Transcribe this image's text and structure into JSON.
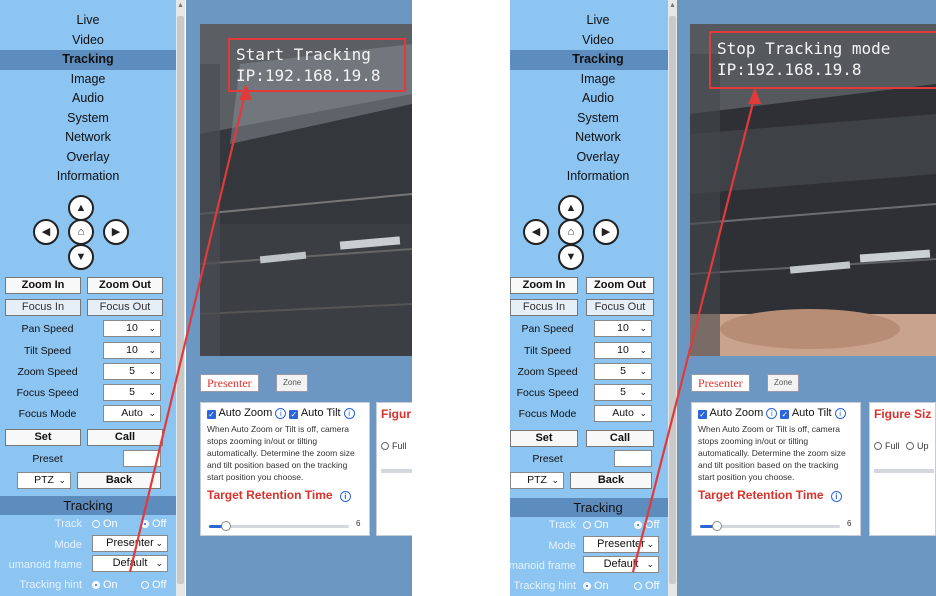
{
  "panels": [
    {
      "menu": [
        "Live",
        "Video",
        "Tracking",
        "Image",
        "Audio",
        "System",
        "Network",
        "Overlay",
        "Information"
      ],
      "active_menu": "Tracking",
      "buttons": {
        "zoom_in": "Zoom In",
        "zoom_out": "Zoom Out",
        "focus_in": "Focus In",
        "focus_out": "Focus Out",
        "set": "Set",
        "call": "Call",
        "back": "Back"
      },
      "speeds": [
        {
          "label": "Pan Speed",
          "value": "10"
        },
        {
          "label": "Tilt Speed",
          "value": "10"
        },
        {
          "label": "Zoom Speed",
          "value": "5"
        },
        {
          "label": "Focus Speed",
          "value": "5"
        },
        {
          "label": "Focus Mode",
          "value": "Auto"
        }
      ],
      "preset_label": "Preset",
      "ptz_select": "PTZ",
      "tracking_header": "Tracking",
      "track": {
        "label": "Track",
        "on": "On",
        "off": "Off",
        "selected": "Off"
      },
      "mode": {
        "label": "Mode",
        "value": "Presenter"
      },
      "frame": {
        "label": "umanoid frame",
        "value": "Default"
      },
      "hint": {
        "label": "Tracking hint",
        "on": "On",
        "off": "Off",
        "selected": "On"
      },
      "overlay": {
        "line1": "Start Tracking",
        "line2": "IP:192.168.19.8"
      },
      "tabs": {
        "active": "Presenter",
        "inactive": "Zone"
      },
      "card": {
        "auto_zoom": "Auto Zoom",
        "auto_tilt": "Auto Tilt",
        "desc": "When Auto Zoom or Tilt is off, camera stops zooming in/out or tilting automatically. Determine the zoom size and tilt position based on the tracking start position you choose.",
        "retention": "Target Retention Time",
        "slider_value": "6",
        "figure": "Figur",
        "option1": "Full",
        "option2": ""
      }
    },
    {
      "menu": [
        "Live",
        "Video",
        "Tracking",
        "Image",
        "Audio",
        "System",
        "Network",
        "Overlay",
        "Information"
      ],
      "active_menu": "Tracking",
      "buttons": {
        "zoom_in": "Zoom In",
        "zoom_out": "Zoom Out",
        "focus_in": "Focus In",
        "focus_out": "Focus Out",
        "set": "Set",
        "call": "Call",
        "back": "Back"
      },
      "speeds": [
        {
          "label": "Pan Speed",
          "value": "10"
        },
        {
          "label": "Tilt Speed",
          "value": "10"
        },
        {
          "label": "Zoom Speed",
          "value": "5"
        },
        {
          "label": "Focus Speed",
          "value": "5"
        },
        {
          "label": "Focus Mode",
          "value": "Auto"
        }
      ],
      "preset_label": "Preset",
      "ptz_select": "PTZ",
      "tracking_header": "Tracking",
      "track": {
        "label": "Track",
        "on": "On",
        "off": "Off",
        "selected": "Off"
      },
      "mode": {
        "label": "Mode",
        "value": "Presenter"
      },
      "frame": {
        "label": "umanoid frame",
        "value": "Default"
      },
      "hint": {
        "label": "Tracking hint",
        "on": "On",
        "off": "Off",
        "selected": "On"
      },
      "overlay": {
        "line1": "Stop Tracking mode",
        "line2": "IP:192.168.19.8"
      },
      "tabs": {
        "active": "Presenter",
        "inactive": "Zone"
      },
      "card": {
        "auto_zoom": "Auto Zoom",
        "auto_tilt": "Auto Tilt",
        "desc": "When Auto Zoom or Tilt is off, camera stops zooming in/out or tilting automatically. Determine the zoom size and tilt position based on the tracking start position you choose.",
        "retention": "Target Retention Time",
        "slider_value": "6",
        "figure": "Figure Siz",
        "option1": "Full",
        "option2": "Up"
      }
    }
  ],
  "colors": {
    "sidebar": "#8cc4f2",
    "main": "#6d97c3",
    "highlight": "#e23a3a",
    "accent": "#2a66d9"
  }
}
